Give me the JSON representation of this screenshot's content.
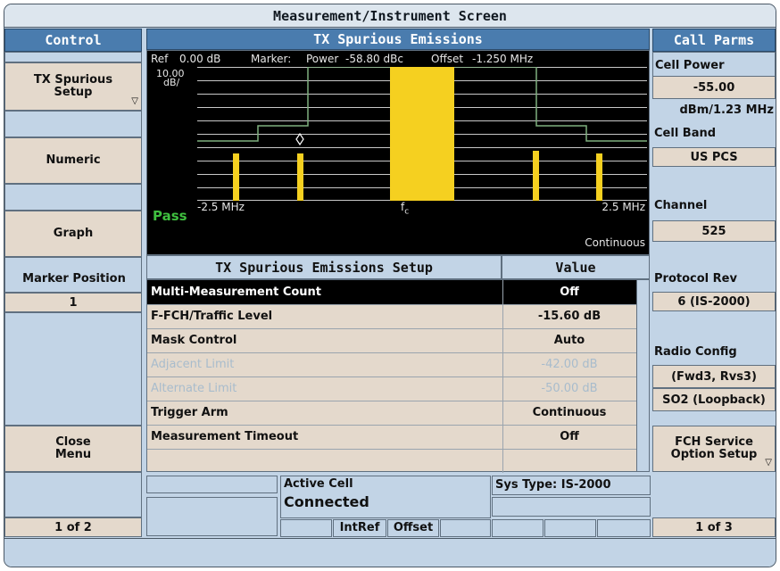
{
  "title": "Measurement/Instrument Screen",
  "control": {
    "header": "Control",
    "buttons": [
      "TX Spurious Setup",
      "Numeric",
      "Graph",
      "Close Menu"
    ],
    "marker_position_label": "Marker Position",
    "marker_position_value": "1",
    "page": "1 of 2"
  },
  "graph": {
    "header": "TX Spurious Emissions",
    "ref_label": "Ref",
    "ref_value": "0.00 dB",
    "marker_label": "Marker:",
    "power_label": "Power",
    "power_value": "-58.80 dBc",
    "offset_label": "Offset",
    "offset_value": "-1.250 MHz",
    "scale_value": "10.00",
    "scale_unit": "dB/",
    "pass_text": "Pass",
    "left_freq": "-2.5 MHz",
    "center_label": "f",
    "center_sub": "c",
    "right_freq": "2.5 MHz",
    "mode": "Continuous",
    "colors": {
      "bars": "#f5d020",
      "mask": "#7fb07f",
      "pass": "#3fbf3f"
    }
  },
  "setup": {
    "header": "TX Spurious Emissions Setup",
    "value_header": "Value",
    "rows": [
      {
        "label": "Multi-Measurement Count",
        "value": "Off"
      },
      {
        "label": "F-FCH/Traffic Level",
        "value": "-15.60 dB"
      },
      {
        "label": "Mask Control",
        "value": "Auto"
      },
      {
        "label": "Adjacent Limit",
        "value": "-42.00 dB"
      },
      {
        "label": "Alternate Limit",
        "value": "-50.00 dB"
      },
      {
        "label": "Trigger Arm",
        "value": "Continuous"
      },
      {
        "label": "Measurement Timeout",
        "value": "Off"
      }
    ]
  },
  "call_parms": {
    "header": "Call Parms",
    "cell_power_label": "Cell Power",
    "cell_power_value": "-55.00",
    "cell_power_unit": "dBm/1.23 MHz",
    "cell_band_label": "Cell Band",
    "cell_band_value": "US PCS",
    "channel_label": "Channel",
    "channel_value": "525",
    "protocol_label": "Protocol Rev",
    "protocol_value": "6 (IS-2000)",
    "radio_label": "Radio Config",
    "radio_value": "(Fwd3, Rvs3)",
    "so_value": "SO2 (Loopback)",
    "fch_button": "FCH Service Option Setup",
    "page": "1 of 3"
  },
  "status": {
    "active_cell_label": "Active Cell",
    "active_cell_value": "Connected",
    "sys_type": "Sys Type: IS-2000",
    "intref": "IntRef",
    "offset": "Offset"
  }
}
